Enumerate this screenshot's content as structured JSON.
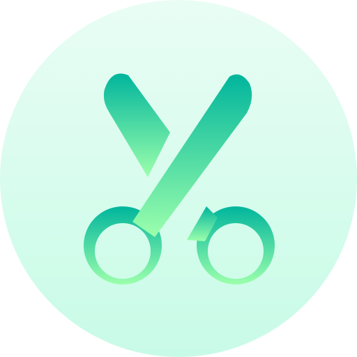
{
  "icon": {
    "name": "scissors-icon",
    "background_colors": [
      "#e9fdf4",
      "#c8fbe7"
    ],
    "glyph_colors": [
      "#00b59c",
      "#9cffac"
    ]
  }
}
